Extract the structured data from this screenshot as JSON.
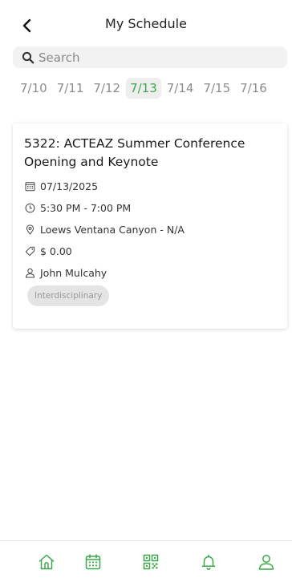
{
  "header": {
    "title": "My Schedule"
  },
  "search": {
    "placeholder": "Search",
    "value": ""
  },
  "dates": [
    {
      "label": "7/10",
      "active": false
    },
    {
      "label": "7/11",
      "active": false
    },
    {
      "label": "7/12",
      "active": false
    },
    {
      "label": "7/13",
      "active": true
    },
    {
      "label": "7/14",
      "active": false
    },
    {
      "label": "7/15",
      "active": false
    },
    {
      "label": "7/16",
      "active": false
    }
  ],
  "session": {
    "title": "5322: ACTEAZ Summer Conference Opening and Keynote",
    "date": "07/13/2025",
    "time": "5:30 PM - 7:00 PM",
    "location": "Loews Ventana Canyon - N/A",
    "price": "$ 0.00",
    "speaker": "John Mulcahy",
    "tag": "Interdisciplinary"
  },
  "nav": {
    "items": [
      {
        "name": "home",
        "icon": "home-icon"
      },
      {
        "name": "agenda",
        "icon": "calendar-icon"
      },
      {
        "name": "qr",
        "icon": "qr-code-icon"
      },
      {
        "name": "notifications",
        "icon": "bell-icon"
      },
      {
        "name": "profile",
        "icon": "user-icon"
      }
    ]
  },
  "colors": {
    "accent": "#3aa84a",
    "muted": "#8c8c8c",
    "tag_bg": "#e4e4e4"
  }
}
